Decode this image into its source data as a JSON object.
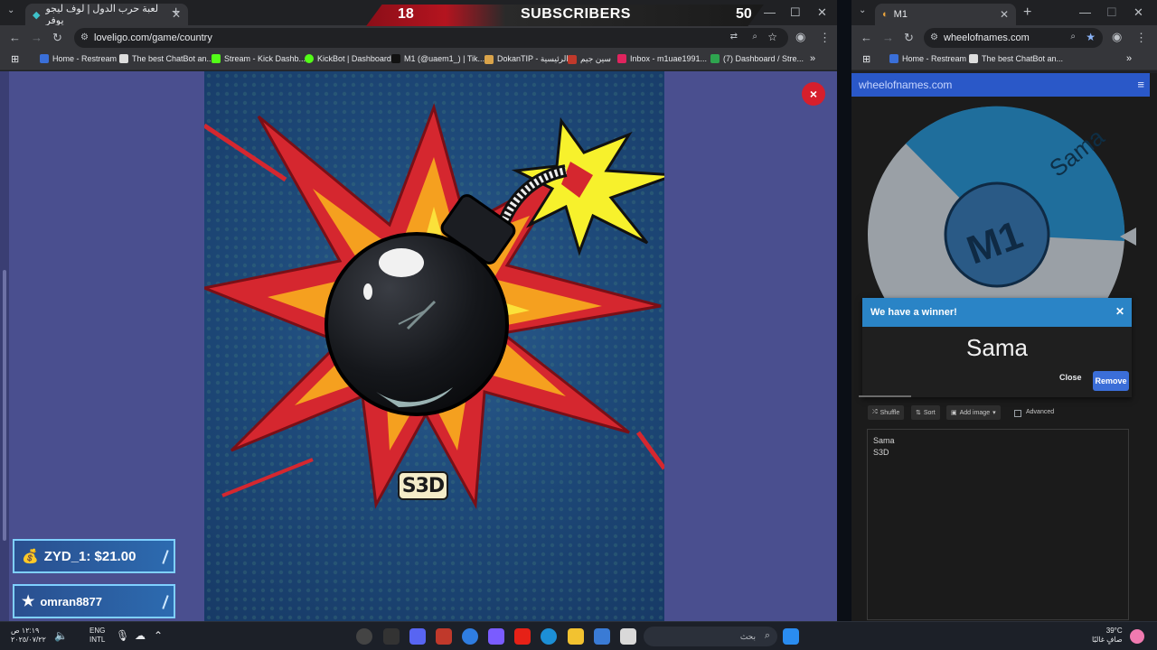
{
  "left_browser": {
    "tab_title": "لعبة حرب الدول | لوف ليجو يوفر",
    "url": "loveligo.com/game/country",
    "bookmarks": [
      "Home - Restream",
      "The best ChatBot an...",
      "Stream - Kick Dashb...",
      "KickBot | Dashboard",
      "M1 (@uaem1_) | Tik...",
      "DokanTIP - الرئيسية",
      "سين جيم",
      "Inbox - m1uae1991...",
      "(7) Dashboard / Stre..."
    ]
  },
  "subscribers": {
    "current": "18",
    "label": "SUBSCRIBERS",
    "goal": "50"
  },
  "game": {
    "player_name": "S3D",
    "close_symbol": "×"
  },
  "alerts": [
    {
      "icon": "money-icon",
      "text": "ZYD_1: $21.00"
    },
    {
      "icon": "star-icon",
      "text": "omran8877"
    }
  ],
  "right_browser": {
    "tab_title": "M1",
    "url": "wheelofnames.com",
    "bookmarks": [
      "Home - Restream",
      "The best ChatBot an..."
    ],
    "site_header": "wheelofnames.com",
    "wheel": {
      "center_label": "M1",
      "segments": [
        "Sama",
        "S3D"
      ],
      "colors": {
        "sama": "#1f6e9c",
        "s3d": "#9aa0a6"
      }
    },
    "winner_dialog": {
      "heading": "We have a winner!",
      "name": "Sama",
      "close_label": "Close",
      "remove_label": "Remove"
    },
    "toolbar": {
      "shuffle": "Shuffle",
      "sort": "Sort",
      "add_image": "Add image",
      "advanced": "Advanced"
    },
    "entries": [
      "Sama",
      "S3D"
    ]
  },
  "taskbar": {
    "time": "١٢:١٩ ص",
    "date": "٢٠٢٥/٠٧/٢٢",
    "lang": "ENG",
    "lang_sub": "INTL",
    "search_placeholder": "بحث",
    "temp": "39°C",
    "weather": "صافٍ غالبًا"
  }
}
